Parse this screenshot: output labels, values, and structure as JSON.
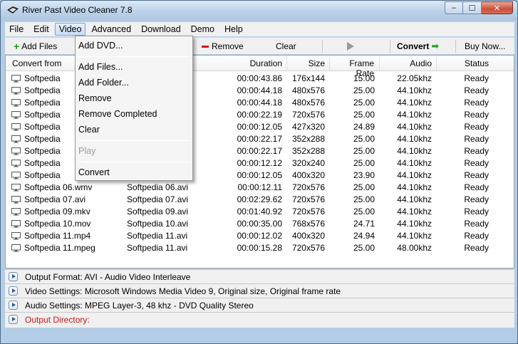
{
  "window": {
    "title": "River Past Video Cleaner 7.8",
    "min": "–",
    "max": "☐",
    "close": "✕"
  },
  "menu": [
    "File",
    "Edit",
    "Video",
    "Advanced",
    "Download",
    "Demo",
    "Help"
  ],
  "toolbar": {
    "add_files": "Add Files",
    "remove": "Remove",
    "clear": "Clear",
    "convert": "Convert",
    "buy_now": "Buy Now..."
  },
  "table": {
    "headers": [
      "Convert from",
      "Duration",
      "Size",
      "Frame Rate",
      "Audio",
      "Status"
    ],
    "rows": [
      {
        "from": "Softpedia",
        "to": "",
        "duration": "00:00:43.86",
        "size": "176x144",
        "fps": "15.00",
        "audio": "22.05khz",
        "status": "Ready"
      },
      {
        "from": "Softpedia",
        "to": "",
        "duration": "00:00:44.18",
        "size": "480x576",
        "fps": "25.00",
        "audio": "44.10khz",
        "status": "Ready"
      },
      {
        "from": "Softpedia",
        "to": "",
        "duration": "00:00:44.18",
        "size": "480x576",
        "fps": "25.00",
        "audio": "44.10khz",
        "status": "Ready"
      },
      {
        "from": "Softpedia",
        "to": "",
        "duration": "00:00:22.19",
        "size": "720x576",
        "fps": "25.00",
        "audio": "44.10khz",
        "status": "Ready"
      },
      {
        "from": "Softpedia",
        "to": "",
        "duration": "00:00:12.05",
        "size": "427x320",
        "fps": "24.89",
        "audio": "44.10khz",
        "status": "Ready"
      },
      {
        "from": "Softpedia",
        "to": "",
        "duration": "00:00:22.17",
        "size": "352x288",
        "fps": "25.00",
        "audio": "44.10khz",
        "status": "Ready"
      },
      {
        "from": "Softpedia",
        "to": "",
        "duration": "00:00:22.17",
        "size": "352x288",
        "fps": "25.00",
        "audio": "44.10khz",
        "status": "Ready"
      },
      {
        "from": "Softpedia",
        "to": "",
        "duration": "00:00:12.12",
        "size": "320x240",
        "fps": "25.00",
        "audio": "44.10khz",
        "status": "Ready"
      },
      {
        "from": "Softpedia",
        "to": "",
        "duration": "00:00:12.05",
        "size": "400x320",
        "fps": "23.90",
        "audio": "44.10khz",
        "status": "Ready"
      },
      {
        "from": "Softpedia 06.wmv",
        "to": "Softpedia 06.avi",
        "duration": "00:00:12.11",
        "size": "720x576",
        "fps": "25.00",
        "audio": "44.10khz",
        "status": "Ready"
      },
      {
        "from": "Softpedia 07.avi",
        "to": "Softpedia 07.avi",
        "duration": "00:02:29.62",
        "size": "720x576",
        "fps": "25.00",
        "audio": "44.10khz",
        "status": "Ready"
      },
      {
        "from": "Softpedia 09.mkv",
        "to": "Softpedia 09.avi",
        "duration": "00:01:40.92",
        "size": "720x576",
        "fps": "25.00",
        "audio": "44.10khz",
        "status": "Ready"
      },
      {
        "from": "Softpedia 10.mov",
        "to": "Softpedia 10.avi",
        "duration": "00:00:35.00",
        "size": "768x576",
        "fps": "24.71",
        "audio": "44.10khz",
        "status": "Ready"
      },
      {
        "from": "Softpedia 11.mp4",
        "to": "Softpedia 11.avi",
        "duration": "00:00:12.02",
        "size": "400x320",
        "fps": "24.94",
        "audio": "44.10khz",
        "status": "Ready"
      },
      {
        "from": "Softpedia 11.mpeg",
        "to": "Softpedia 11.avi",
        "duration": "00:00:15.28",
        "size": "720x576",
        "fps": "25.00",
        "audio": "48.00khz",
        "status": "Ready"
      }
    ]
  },
  "settings": {
    "output_format": "Output Format: AVI - Audio Video Interleave",
    "video": "Video Settings: Microsoft Windows Media Video 9, Original size, Original frame rate",
    "audio": "Audio Settings: MPEG Layer-3, 48 khz - DVD Quality Stereo",
    "output_dir": "Output Directory:"
  },
  "video_menu": {
    "add_dvd": "Add DVD...",
    "add_files": "Add Files...",
    "add_folder": "Add Folder...",
    "remove": "Remove",
    "remove_completed": "Remove Completed",
    "clear": "Clear",
    "play": "Play",
    "convert": "Convert"
  },
  "colors": {
    "accent_red": "#d01010",
    "add_green": "#1a9a1a"
  }
}
